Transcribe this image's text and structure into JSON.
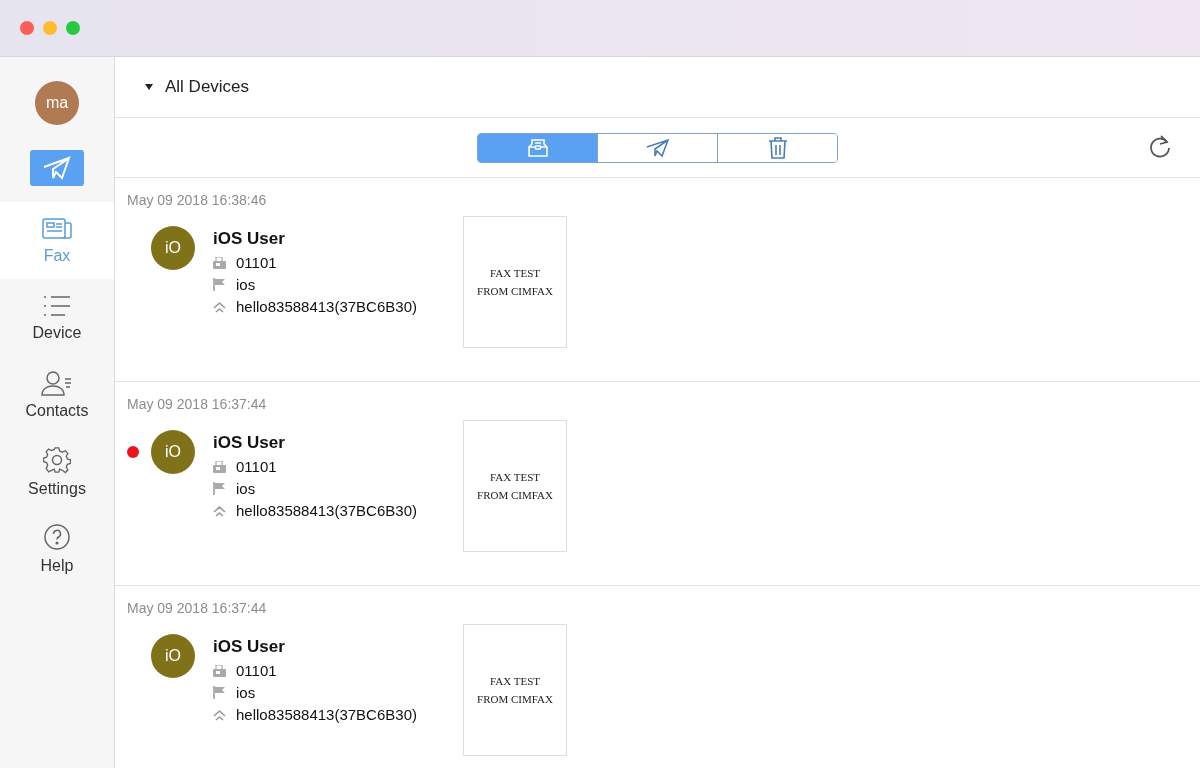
{
  "sidebar": {
    "avatar": "ma",
    "items": [
      {
        "kind": "fax",
        "label": "Fax",
        "selected": true
      },
      {
        "kind": "device",
        "label": "Device",
        "selected": false
      },
      {
        "kind": "contacts",
        "label": "Contacts",
        "selected": false
      },
      {
        "kind": "settings",
        "label": "Settings",
        "selected": false
      },
      {
        "kind": "help",
        "label": "Help",
        "selected": false
      }
    ]
  },
  "header": {
    "title": "All Devices"
  },
  "toolbar": {
    "segments": [
      {
        "kind": "inbox",
        "selected": true
      },
      {
        "kind": "sent",
        "selected": false
      },
      {
        "kind": "trash",
        "selected": false
      }
    ]
  },
  "faxes": [
    {
      "date": "May 09 2018 16:38:46",
      "unread": false,
      "initials": "iO",
      "name": "iOS User",
      "number": "01101",
      "tag": "ios",
      "device": "hello83588413(37BC6B30)",
      "preview": [
        "FAX TEST",
        "FROM CIMFAX"
      ]
    },
    {
      "date": "May 09 2018 16:37:44",
      "unread": true,
      "initials": "iO",
      "name": "iOS User",
      "number": "01101",
      "tag": "ios",
      "device": "hello83588413(37BC6B30)",
      "preview": [
        "FAX TEST",
        "FROM CIMFAX"
      ]
    },
    {
      "date": "May 09 2018 16:37:44",
      "unread": false,
      "initials": "iO",
      "name": "iOS User",
      "number": "01101",
      "tag": "ios",
      "device": "hello83588413(37BC6B30)",
      "preview": [
        "FAX TEST",
        "FROM CIMFAX"
      ]
    }
  ]
}
